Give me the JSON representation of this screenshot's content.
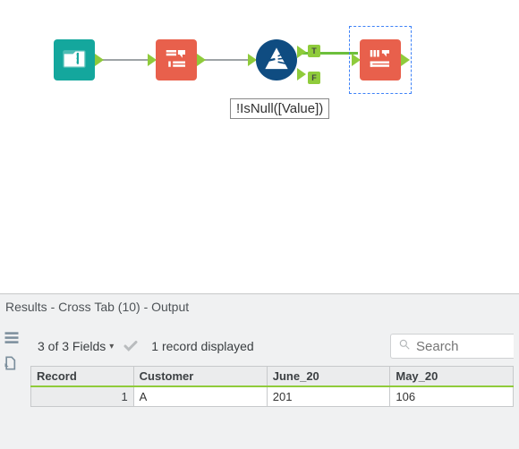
{
  "workflow": {
    "nodes": {
      "folder": {
        "type": "input-folder"
      },
      "transpose": {
        "type": "transpose-tool"
      },
      "filter": {
        "type": "filter-tool",
        "expression": "!IsNull([Value])",
        "t_label": "T",
        "f_label": "F"
      },
      "crosstab": {
        "type": "cross-tab-tool",
        "selected": true
      }
    }
  },
  "results": {
    "title": "Results - Cross Tab (10) - Output",
    "fields_summary": "3 of 3 Fields",
    "records_summary": "1 record displayed",
    "search_placeholder": "Search",
    "columns": [
      "Record",
      "Customer",
      "June_20",
      "May_20"
    ],
    "rows": [
      {
        "record": "1",
        "Customer": "A",
        "June_20": "201",
        "May_20": "106"
      }
    ]
  }
}
